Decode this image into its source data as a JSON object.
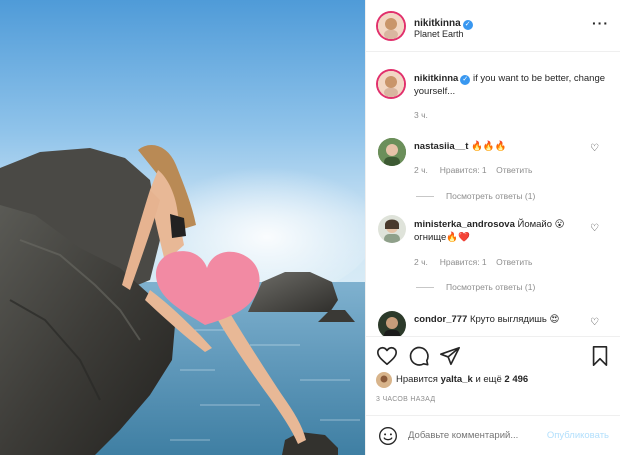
{
  "header": {
    "username": "nikitkinna",
    "location": "Planet Earth"
  },
  "caption": {
    "username": "nikitkinna",
    "text": "if you want to be better, change yourself...",
    "time": "3 ч."
  },
  "comments": [
    {
      "username": "nastasiia__t",
      "text": "🔥🔥🔥",
      "time": "2 ч.",
      "likes": "Нравится: 1",
      "reply_label": "Ответить",
      "view_replies": "Посмотреть ответы (1)"
    },
    {
      "username": "ministerka_androsova",
      "text": "Йомайо 😮 огнище🔥❤️",
      "time": "2 ч.",
      "likes": "Нравится: 1",
      "reply_label": "Ответить",
      "view_replies": "Посмотреть ответы (1)"
    },
    {
      "username": "condor_777",
      "text": "Круто выглядишь 😍",
      "time": "",
      "likes": "",
      "reply_label": "",
      "view_replies": ""
    }
  ],
  "likes": {
    "prefix": "Нравится",
    "user": "yalta_k",
    "suffix": "и ещё",
    "count": "2 496"
  },
  "posted_ago": "3 ЧАСОВ НАЗАД",
  "comment_input": {
    "placeholder": "Добавьте комментарий...",
    "post_label": "Опубликовать"
  },
  "icons": {
    "like": "heart-icon",
    "comment": "comment-icon",
    "share": "share-icon",
    "save": "bookmark-icon",
    "emoji": "emoji-icon",
    "more": "more-icon"
  },
  "colors": {
    "verified": "#3897f0",
    "post_button": "#b2dffc",
    "muted": "#8e8e8e"
  }
}
